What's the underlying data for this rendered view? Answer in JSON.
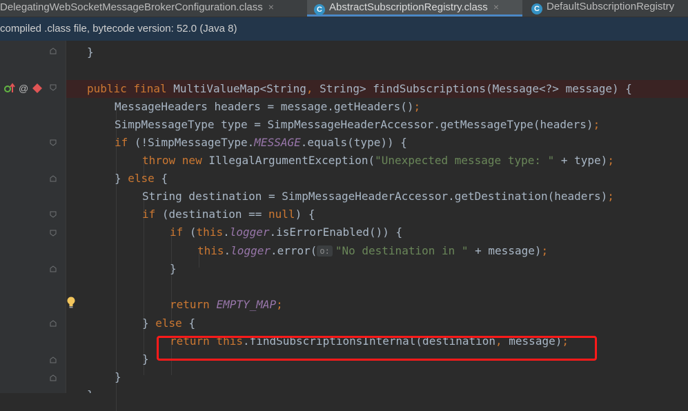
{
  "tabs": [
    {
      "label": "DelegatingWebSocketMessageBrokerConfiguration.class",
      "close": "×",
      "active": false
    },
    {
      "label": "AbstractSubscriptionRegistry.class",
      "close": "×",
      "active": true,
      "icon": "C"
    },
    {
      "label": "DefaultSubscriptionRegistry",
      "active": false,
      "icon": "C"
    }
  ],
  "infobar": {
    "text": "compiled .class file, bytecode version: 52.0 (Java 8)"
  },
  "editor": {
    "hint_label": "o:"
  },
  "colors": {
    "keyword": "#cc7832",
    "string": "#6a8759",
    "field": "#9876aa",
    "text": "#a9b7c6",
    "highlight_box": "#ff1a1a"
  }
}
